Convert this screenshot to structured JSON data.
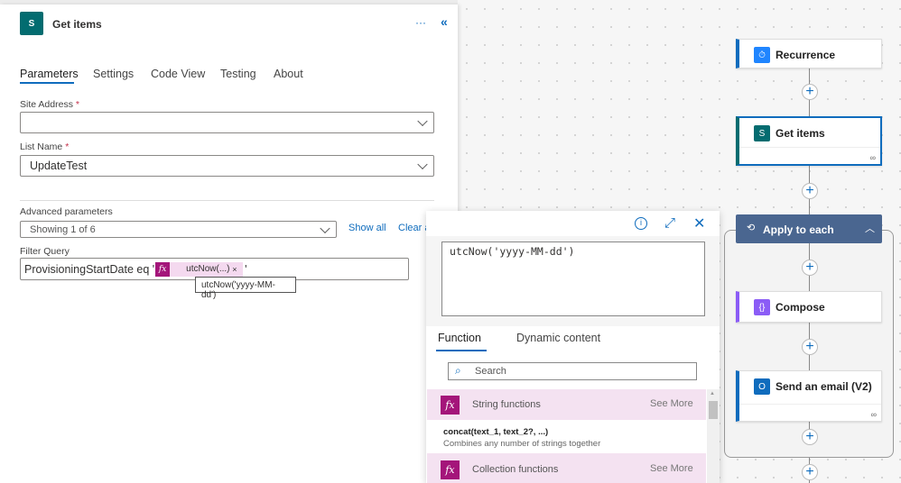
{
  "panel": {
    "title": "Get items",
    "more": "···",
    "collapse": "«",
    "tabs": [
      "Parameters",
      "Settings",
      "Code View",
      "Testing",
      "About"
    ],
    "site_address": {
      "label": "Site Address",
      "required": "*",
      "value": ""
    },
    "list_name": {
      "label": "List Name",
      "required": "*",
      "value": "UpdateTest"
    },
    "advanced": {
      "label": "Advanced parameters",
      "value": "Showing 1 of 6",
      "show_all": "Show all",
      "clear_all": "Clear a"
    },
    "filter": {
      "label": "Filter Query",
      "prefix": "ProvisioningStartDate eq '",
      "token": "utcNow(...)",
      "token_close": "×",
      "suffix": "'",
      "tooltip": "utcNow('yyyy-MM-dd')"
    }
  },
  "popup": {
    "expression": "utcNow('yyyy-MM-dd')",
    "tabs": [
      "Function",
      "Dynamic content"
    ],
    "search_placeholder": "Search",
    "rows": [
      {
        "type": "category",
        "label": "String functions",
        "action": "See More"
      },
      {
        "type": "function",
        "label": "concat(text_1, text_2?, ...)",
        "desc": "Combines any number of strings together"
      },
      {
        "type": "category",
        "label": "Collection functions",
        "action": "See More"
      }
    ]
  },
  "flow": {
    "nodes": [
      "Recurrence",
      "Get items",
      "Apply to each",
      "Compose",
      "Send an email (V2)"
    ]
  },
  "colors": {
    "accent": "#0f6cbd",
    "fx": "#a4157a",
    "sharepoint": "#036c70",
    "loop": "#4a6690"
  }
}
